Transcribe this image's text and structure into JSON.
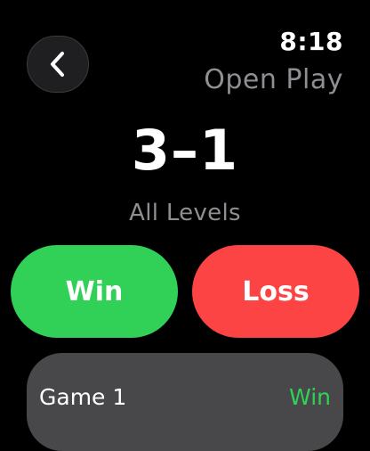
{
  "status_bar": {
    "time": "8:18"
  },
  "header": {
    "title": "Open Play",
    "back_icon": "chevron-left-icon"
  },
  "summary": {
    "score": "3–1",
    "level": "All Levels"
  },
  "actions": {
    "win_label": "Win",
    "loss_label": "Loss"
  },
  "games": [
    {
      "label": "Game 1",
      "result": "Win"
    }
  ],
  "colors": {
    "background": "#000000",
    "win": "#31d158",
    "loss": "#fd4444",
    "secondary_text": "#8e8e93",
    "row_background": "#48484b",
    "back_button_background": "#1f1f21"
  }
}
